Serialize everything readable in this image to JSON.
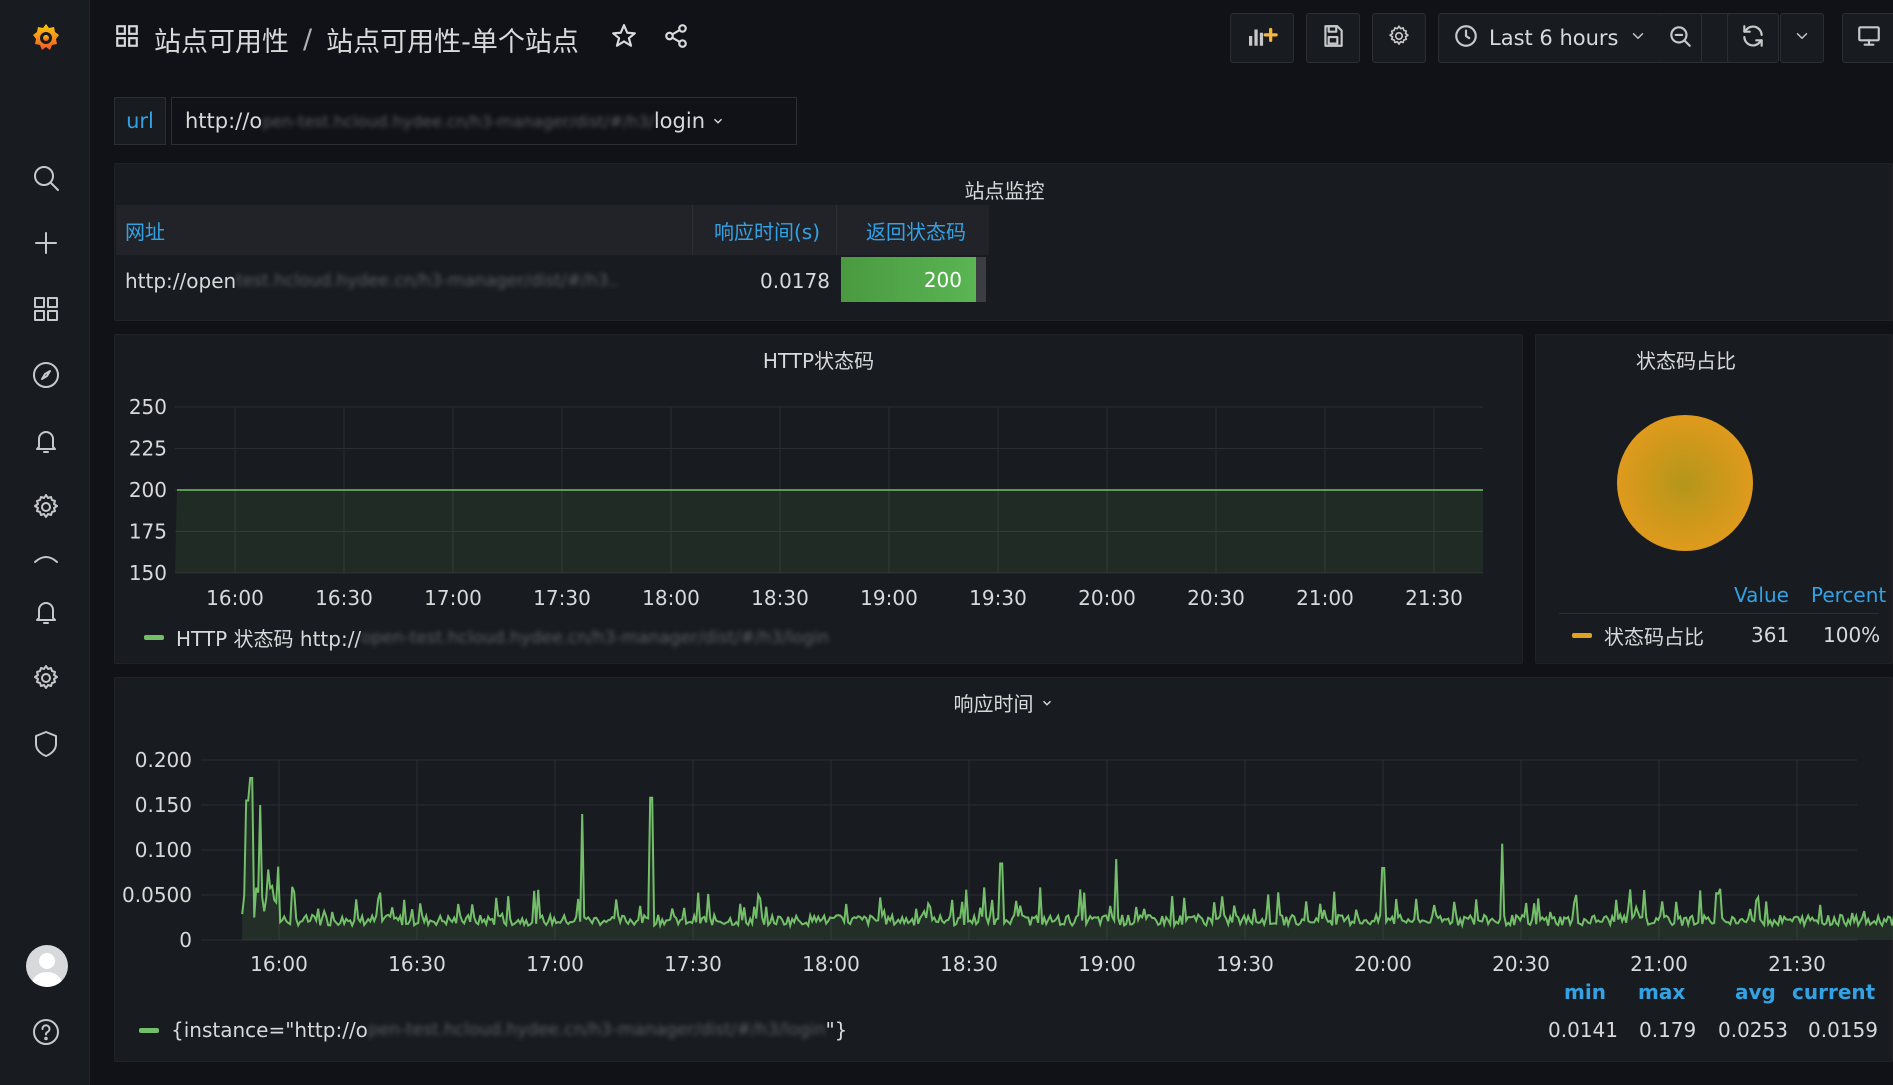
{
  "breadcrumb": {
    "folder": "站点可用性",
    "separator": "/",
    "dashboard": "站点可用性-单个站点"
  },
  "time_picker": {
    "label": "Last 6 hours"
  },
  "variable": {
    "label": "url",
    "value_prefix": "http://o",
    "value_hidden": "pen-test.hcloud.hydee.cn/h3-manager/dist/#/h3/",
    "value_suffix": "login"
  },
  "site_panel": {
    "title": "站点监控",
    "columns": [
      "网址",
      "响应时间(s)",
      "返回状态码"
    ],
    "row": {
      "url_visible": "http://open",
      "url_hidden": "test.hcloud.hydee.cn/h3-manager/dist/#/h3..",
      "response_time": "0.0178",
      "status_code": "200"
    },
    "status_color": "#56a64b"
  },
  "http_panel": {
    "title": "HTTP状态码",
    "legend_prefix": "HTTP 状态码 http://",
    "legend_hidden": "open-test.hcloud.hydee.cn/h3-manager/dist/#/h3/login",
    "series_color": "#73bf69"
  },
  "pie_panel": {
    "title": "状态码占比",
    "headers": [
      "Value",
      "Percent"
    ],
    "legend_label": "状态码占比",
    "value": "361",
    "percent": "100%",
    "color": "#e0a321"
  },
  "resp_panel": {
    "title": "响应时间",
    "legend_prefix": "{instance=\"http://o",
    "legend_hidden": "pen-test.hcloud.hydee.cn/h3-manager/dist/#/h3/login",
    "legend_suffix": "\"}",
    "stats_headers": [
      "min",
      "max",
      "avg",
      "current"
    ],
    "stats_values": [
      "0.0141",
      "0.179",
      "0.0253",
      "0.0159"
    ],
    "series_color": "#73bf69"
  },
  "chart_data": [
    {
      "type": "area",
      "title": "HTTP状态码",
      "x_ticks": [
        "16:00",
        "16:30",
        "17:00",
        "17:30",
        "18:00",
        "18:30",
        "19:00",
        "19:30",
        "20:00",
        "20:30",
        "21:00",
        "21:30"
      ],
      "y_ticks": [
        "150",
        "175",
        "200",
        "225",
        "250"
      ],
      "ylim": [
        150,
        250
      ],
      "series": [
        {
          "values": [
            200,
            200,
            200,
            200,
            200,
            200,
            200,
            200,
            200,
            200,
            200,
            200,
            200
          ]
        }
      ],
      "grid": true
    },
    {
      "type": "pie",
      "title": "状态码占比",
      "slices": [
        {
          "label": "状态码占比",
          "value": 361,
          "percent": 100
        }
      ]
    },
    {
      "type": "line",
      "title": "响应时间",
      "x_ticks": [
        "16:00",
        "16:30",
        "17:00",
        "17:30",
        "18:00",
        "18:30",
        "19:00",
        "19:30",
        "20:00",
        "20:30",
        "21:00",
        "21:30"
      ],
      "y_ticks": [
        "0",
        "0.0500",
        "0.100",
        "0.150",
        "0.200"
      ],
      "ylim": [
        0,
        0.2
      ],
      "spikes": [
        {
          "time": "15:53",
          "value": 0.155
        },
        {
          "time": "15:54",
          "value": 0.18
        },
        {
          "time": "15:56",
          "value": 0.15
        },
        {
          "time": "17:06",
          "value": 0.14
        },
        {
          "time": "17:21",
          "value": 0.158
        },
        {
          "time": "18:37",
          "value": 0.085
        },
        {
          "time": "19:02",
          "value": 0.09
        },
        {
          "time": "20:00",
          "value": 0.08
        },
        {
          "time": "20:26",
          "value": 0.107
        }
      ],
      "baseline": 0.0253,
      "grid": true
    }
  ]
}
